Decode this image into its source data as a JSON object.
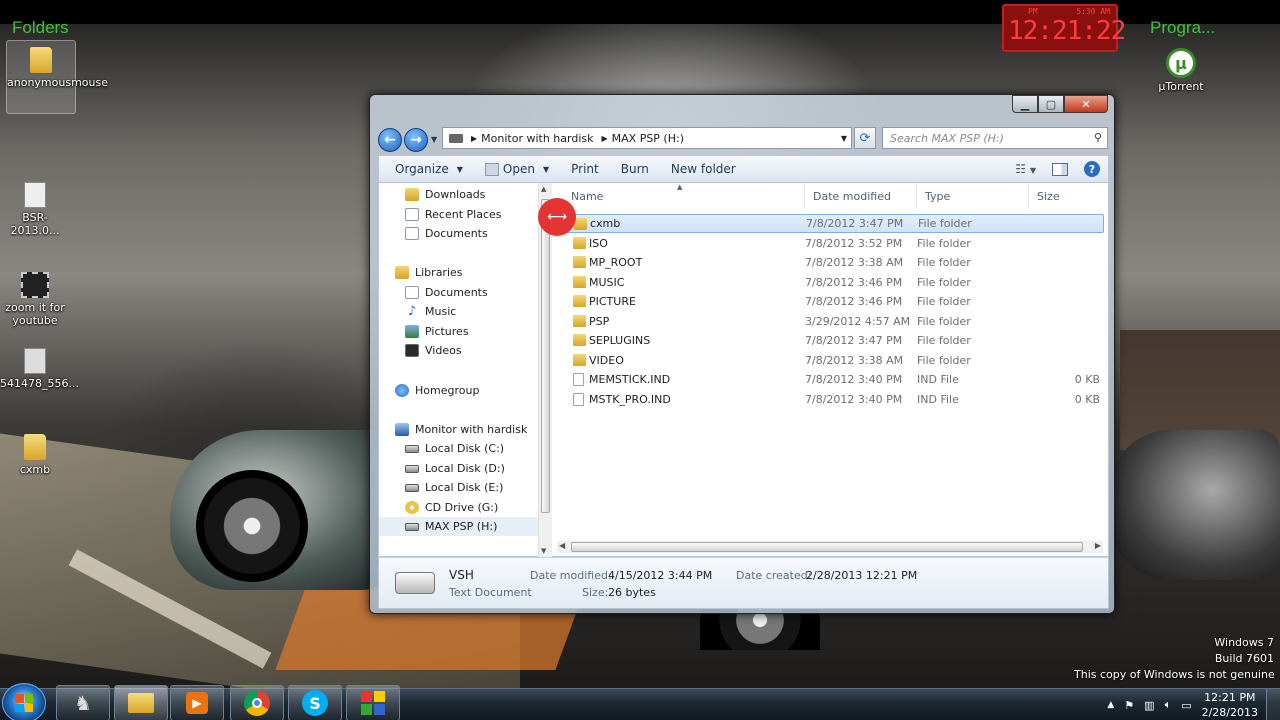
{
  "desktop": {
    "gadget_left_title": "Folders",
    "gadget_right_title": "Progra...",
    "icons_left": [
      {
        "label": "anonymousmouse"
      },
      {
        "label": "BSR-2013.0..."
      },
      {
        "label": "zoom it for youtube"
      },
      {
        "label": "541478_556..."
      },
      {
        "label": "cxmb"
      }
    ],
    "icon_right": {
      "label": "µTorrent"
    },
    "clock_gadget": {
      "period": "PM",
      "alarm": "5:30 AM",
      "time": "12:21:22"
    },
    "windows_info": {
      "line1": "Windows 7",
      "line2": "Build 7601",
      "line3": "This copy of Windows is not genuine"
    }
  },
  "explorer": {
    "address": {
      "seg1": "Monitor with hardisk",
      "seg2": "MAX PSP (H:)"
    },
    "search": {
      "placeholder": "Search MAX PSP (H:)"
    },
    "toolbar": {
      "organize": "Organize",
      "open": "Open",
      "print": "Print",
      "burn": "Burn",
      "new_folder": "New folder"
    },
    "nav": [
      {
        "label": "Downloads",
        "icon": "downloads-icon"
      },
      {
        "label": "Recent Places",
        "icon": "recent-places-icon"
      },
      {
        "label": "Documents",
        "icon": "documents-icon"
      },
      {
        "label": "Libraries",
        "icon": "libraries-icon"
      },
      {
        "label": "Documents",
        "icon": "documents-icon"
      },
      {
        "label": "Music",
        "icon": "music-icon"
      },
      {
        "label": "Pictures",
        "icon": "pictures-icon"
      },
      {
        "label": "Videos",
        "icon": "videos-icon"
      },
      {
        "label": "Homegroup",
        "icon": "homegroup-icon"
      },
      {
        "label": "Monitor with hardisk",
        "icon": "computer-icon"
      },
      {
        "label": "Local Disk (C:)",
        "icon": "disk-icon"
      },
      {
        "label": "Local Disk (D:)",
        "icon": "disk-icon"
      },
      {
        "label": "Local Disk (E:)",
        "icon": "disk-icon"
      },
      {
        "label": "CD Drive (G:)",
        "icon": "cd-drive-icon"
      },
      {
        "label": "MAX PSP (H:)",
        "icon": "removable-disk-icon"
      }
    ],
    "columns": {
      "name": "Name",
      "date": "Date modified",
      "type": "Type",
      "size": "Size"
    },
    "files": [
      {
        "name": "cxmb",
        "date": "7/8/2012 3:47 PM",
        "type": "File folder",
        "size": ""
      },
      {
        "name": "ISO",
        "date": "7/8/2012 3:52 PM",
        "type": "File folder",
        "size": ""
      },
      {
        "name": "MP_ROOT",
        "date": "7/8/2012 3:38 AM",
        "type": "File folder",
        "size": ""
      },
      {
        "name": "MUSIC",
        "date": "7/8/2012 3:46 PM",
        "type": "File folder",
        "size": ""
      },
      {
        "name": "PICTURE",
        "date": "7/8/2012 3:46 PM",
        "type": "File folder",
        "size": ""
      },
      {
        "name": "PSP",
        "date": "3/29/2012 4:57 AM",
        "type": "File folder",
        "size": ""
      },
      {
        "name": "SEPLUGINS",
        "date": "7/8/2012 3:47 PM",
        "type": "File folder",
        "size": ""
      },
      {
        "name": "VIDEO",
        "date": "7/8/2012 3:38 AM",
        "type": "File folder",
        "size": ""
      },
      {
        "name": "MEMSTICK.IND",
        "date": "7/8/2012 3:40 PM",
        "type": "IND File",
        "size": "0 KB"
      },
      {
        "name": "MSTK_PRO.IND",
        "date": "7/8/2012 3:40 PM",
        "type": "IND File",
        "size": "0 KB"
      }
    ],
    "details": {
      "name": "VSH",
      "kind": "Text Document",
      "modified_label": "Date modified:",
      "modified_value": "4/15/2012 3:44 PM",
      "created_label": "Date created:",
      "created_value": "2/28/2013 12:21 PM",
      "size_label": "Size:",
      "size_value": "26 bytes"
    }
  },
  "taskbar": {
    "time": "12:21 PM",
    "date": "2/28/2013"
  }
}
